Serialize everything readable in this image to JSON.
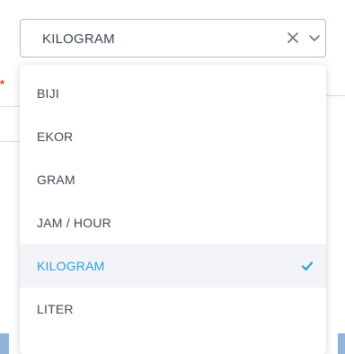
{
  "select": {
    "value": "KILOGRAM",
    "clear_icon": "close-icon",
    "toggle_icon": "chevron-down-icon"
  },
  "background": {
    "required_marker": "*"
  },
  "dropdown": {
    "options": [
      {
        "label": "BIJI",
        "selected": false
      },
      {
        "label": "EKOR",
        "selected": false
      },
      {
        "label": "GRAM",
        "selected": false
      },
      {
        "label": "JAM / HOUR",
        "selected": false
      },
      {
        "label": "KILOGRAM",
        "selected": true
      },
      {
        "label": "LITER",
        "selected": false
      }
    ],
    "selected_icon": "checkmark-icon"
  },
  "colors": {
    "accent": "#2a9fde",
    "selected_bg": "#f2f4f7",
    "required": "#e53935"
  }
}
